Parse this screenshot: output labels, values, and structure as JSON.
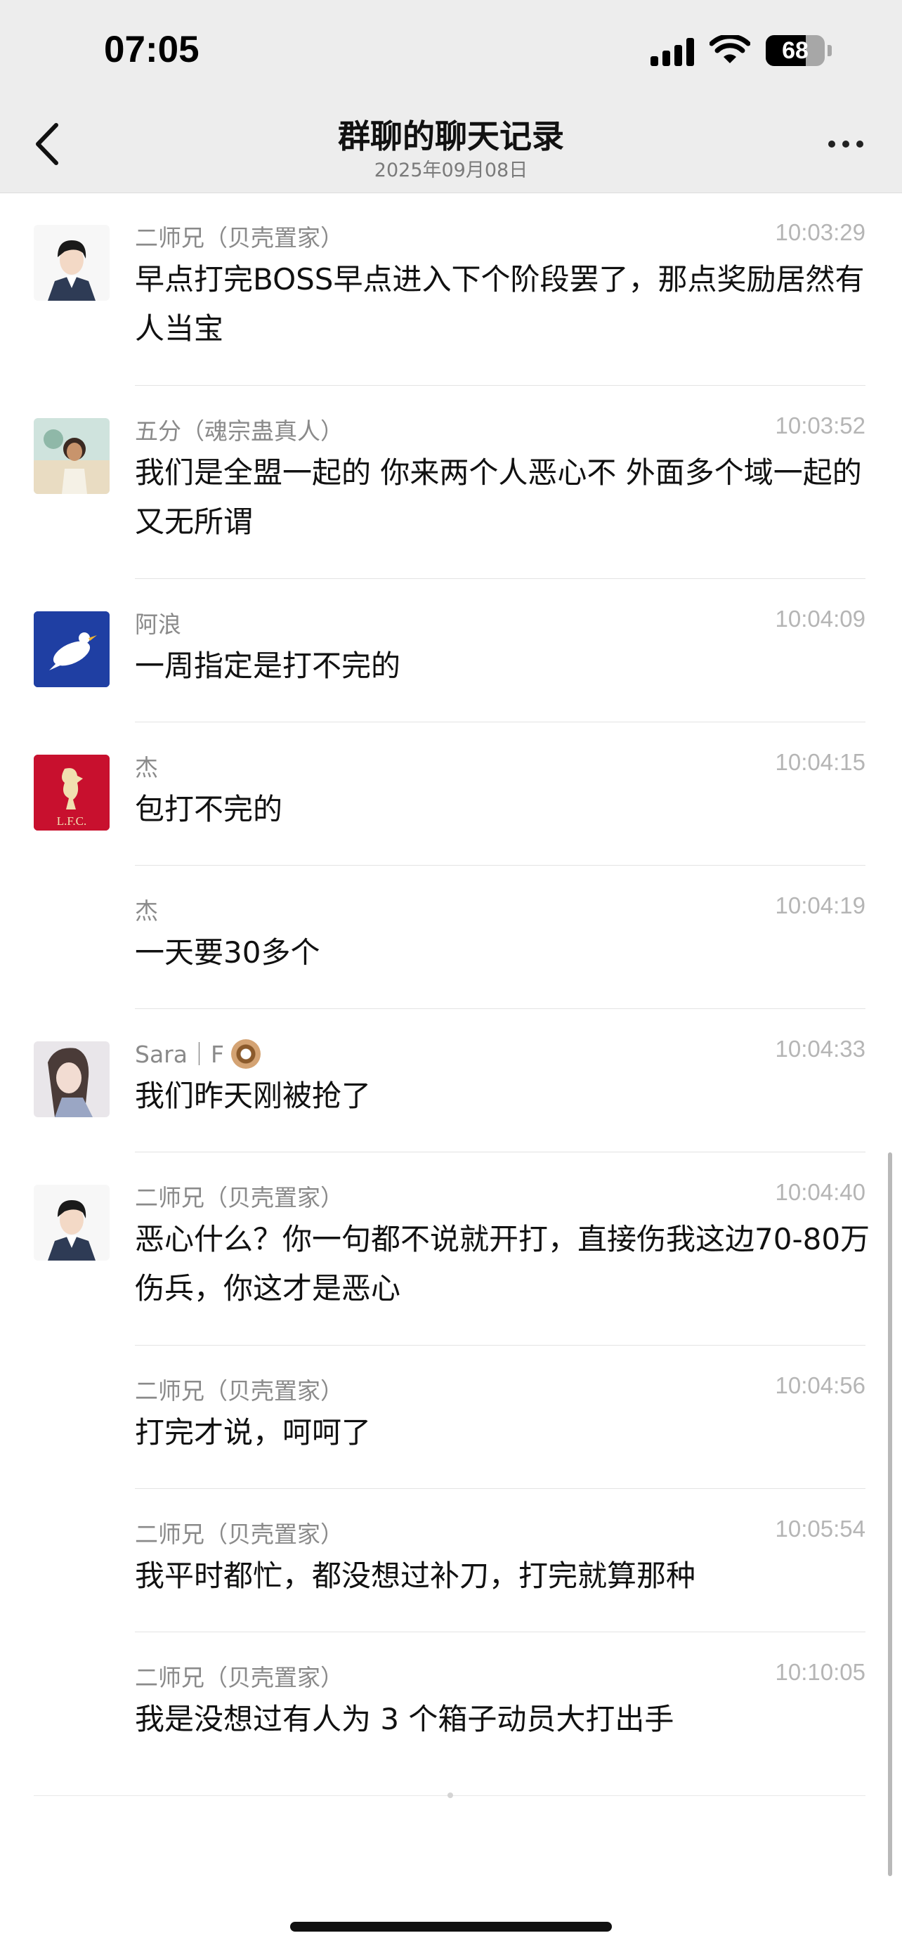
{
  "status_bar": {
    "time": "07:05",
    "battery": "68",
    "battery_level": 0.68
  },
  "header": {
    "title": "群聊的聊天记录",
    "subtitle": "2025年09月08日"
  },
  "messages": [
    {
      "sender": "二师兄（贝壳置家）",
      "time": "10:03:29",
      "text": "早点打完BOSS早点进入下个阶段罢了，那点奖励居然有人当宝"
    },
    {
      "sender": "五分（魂宗蛊真人）",
      "time": "10:03:52",
      "text": "我们是全盟一起的 你来两个人恶心不 外面多个域一起的又无所谓"
    },
    {
      "sender": "阿浪",
      "time": "10:04:09",
      "text": "一周指定是打不完的"
    },
    {
      "sender": "杰",
      "time": "10:04:15",
      "text": "包打不完的"
    },
    {
      "sender": "杰",
      "time": "10:04:19",
      "text": "一天要30多个"
    },
    {
      "sender": "Sara｜F",
      "time": "10:04:33",
      "text": "我们昨天刚被抢了"
    },
    {
      "sender": "二师兄（贝壳置家）",
      "time": "10:04:40",
      "text": "恶心什么？你一句都不说就开打，直接伤我这边70-80万伤兵，你这才是恶心"
    },
    {
      "sender": "二师兄（贝壳置家）",
      "time": "10:04:56",
      "text": "打完才说，呵呵了"
    },
    {
      "sender": "二师兄（贝壳置家）",
      "time": "10:05:54",
      "text": "我平时都忙，都没想过补刀，打完就算那种"
    },
    {
      "sender": "二师兄（贝壳置家）",
      "time": "10:10:05",
      "text": "我是没想过有人为 3 个箱子动员大打出手"
    }
  ]
}
